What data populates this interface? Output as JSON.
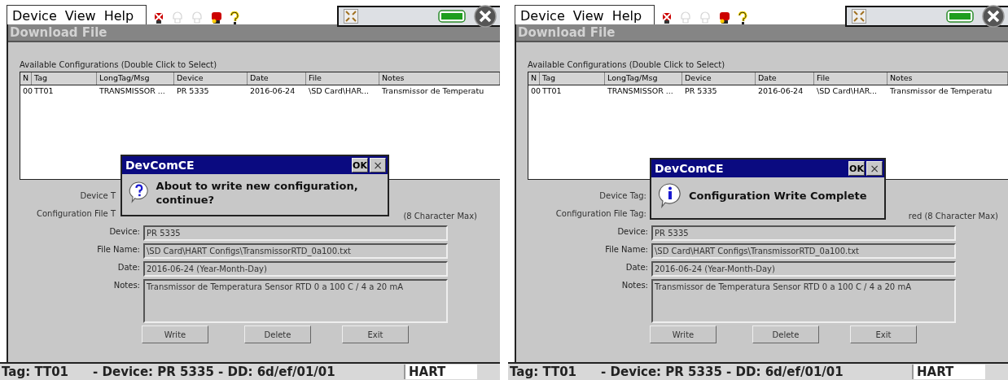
{
  "panels": [
    {
      "menu": [
        "Device",
        "View",
        "Help"
      ],
      "toolbar": [
        {
          "kind": "device-x",
          "disabled": false
        },
        {
          "kind": "probe",
          "disabled": true
        },
        {
          "kind": "probe",
          "disabled": true
        },
        {
          "kind": "device-key",
          "disabled": false
        },
        {
          "kind": "help",
          "disabled": false
        }
      ],
      "window_title": "Download File",
      "table": {
        "caption": "Available Configurations (Double Click to Select)",
        "columns": [
          "N",
          "Tag",
          "LongTag/Msg",
          "Device",
          "Date",
          "File",
          "Notes"
        ],
        "rows": [
          [
            "00",
            "TT01",
            "TRANSMISSOR ...",
            "PR 5335",
            "2016-06-24",
            "\\SD Card\\HAR...",
            "Transmissor de Temperatu"
          ]
        ]
      },
      "form": {
        "device_tag_label": "Device T",
        "config_tag_label": "Configuration File T",
        "config_tag_hint": "(8 Character Max)",
        "fields": [
          {
            "label": "Device:",
            "value": "PR 5335"
          },
          {
            "label": "File Name:",
            "value": "\\SD Card\\HART Configs\\TransmissorRTD_0a100.txt"
          },
          {
            "label": "Date:",
            "value": "2016-06-24 (Year-Month-Day)"
          },
          {
            "label": "Notes:",
            "value": "Transmissor de Temperatura Sensor RTD 0 a 100 C / 4 a 20 mA",
            "kind": "multiline"
          }
        ]
      },
      "buttons": [
        "Write",
        "Delete",
        "Exit"
      ],
      "dialog": {
        "title": "DevComCE",
        "ok": "OK",
        "close": "×",
        "kind": "question",
        "message": "About to write new configuration, continue?"
      },
      "status": {
        "left": "Tag: TT01",
        "middle": "- Device: PR 5335 - DD: 6d/ef/01/01",
        "right": "HART"
      }
    },
    {
      "menu": [
        "Device",
        "View",
        "Help"
      ],
      "toolbar": [
        {
          "kind": "device-x",
          "disabled": false
        },
        {
          "kind": "probe",
          "disabled": true
        },
        {
          "kind": "probe",
          "disabled": true
        },
        {
          "kind": "device-key",
          "disabled": false
        },
        {
          "kind": "help",
          "disabled": false
        }
      ],
      "window_title": "Download File",
      "table": {
        "caption": "Available Configurations (Double Click to Select)",
        "columns": [
          "N",
          "Tag",
          "LongTag/Msg",
          "Device",
          "Date",
          "File",
          "Notes"
        ],
        "rows": [
          [
            "00",
            "TT01",
            "TRANSMISSOR ...",
            "PR 5335",
            "2016-06-24",
            "\\SD Card\\HAR...",
            "Transmissor de Temperatu"
          ]
        ]
      },
      "form": {
        "device_tag_label": "Device Tag:",
        "config_tag_label": "Configuration File Tag:",
        "config_tag_hint": "red (8 Character Max)",
        "fields": [
          {
            "label": "Device:",
            "value": "PR 5335"
          },
          {
            "label": "File Name:",
            "value": "\\SD Card\\HART Configs\\TransmissorRTD_0a100.txt"
          },
          {
            "label": "Date:",
            "value": "2016-06-24 (Year-Month-Day)"
          },
          {
            "label": "Notes:",
            "value": "Transmissor de Temperatura Sensor RTD 0 a 100 C / 4 a 20 mA",
            "kind": "multiline"
          }
        ]
      },
      "buttons": [
        "Write",
        "Delete",
        "Exit"
      ],
      "dialog": {
        "title": "DevComCE",
        "ok": "OK",
        "close": "×",
        "kind": "info",
        "message": "Configuration Write Complete"
      },
      "status": {
        "left": "Tag: TT01",
        "middle": "- Device: PR 5335 - DD: 6d/ef/01/01",
        "right": "HART"
      }
    }
  ]
}
